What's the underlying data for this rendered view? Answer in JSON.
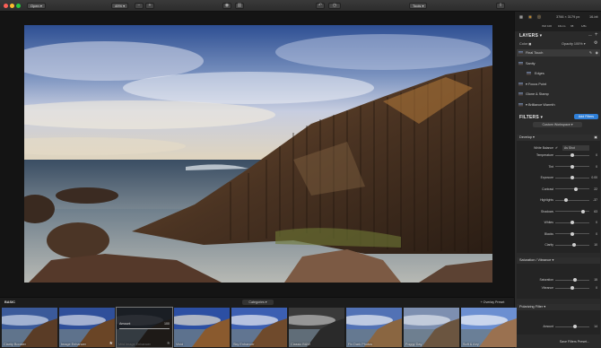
{
  "titlebar": {
    "open_label": "Open ▾",
    "zoom_label": "49% ▾",
    "tools_label": "Tools ▾"
  },
  "meta": {
    "dims": "3766 × 3179 px",
    "bitdepth": "16-bit",
    "iso": "ISO 100",
    "focal": "16mm",
    "fstop": "f/8",
    "exposure": "1/8s"
  },
  "layers": {
    "title": "LAYERS ▾",
    "color_label": "Color ◼",
    "opacity_label": "Opacity 100% ▾",
    "items": [
      {
        "label": "Final Touch"
      },
      {
        "label": "Sanity"
      },
      {
        "label": "Edges"
      },
      {
        "label": "▾ Focus Point"
      },
      {
        "label": "Glone & Stamp"
      },
      {
        "label": "▾ Brilliance Warmth"
      }
    ]
  },
  "filters": {
    "title": "FILTERS ▾",
    "add_label": "Add Filters",
    "workspace_label": "Custom Workspace ▾"
  },
  "develop": {
    "title": "Develop ▾",
    "wb_label": "White Balance",
    "wb_value": "As Shot",
    "sliders": [
      {
        "label": "Temperature",
        "value": "0",
        "pos": 0.5
      },
      {
        "label": "Tint",
        "value": "0",
        "pos": 0.5
      },
      {
        "label": "Exposure",
        "value": "0.00",
        "pos": 0.5
      },
      {
        "label": "Contrast",
        "value": "22",
        "pos": 0.61
      },
      {
        "label": "Highlights",
        "value": "-37",
        "pos": 0.31
      },
      {
        "label": "Shadows",
        "value": "63",
        "pos": 0.81
      },
      {
        "label": "Whites",
        "value": "0",
        "pos": 0.5
      },
      {
        "label": "Blacks",
        "value": "0",
        "pos": 0.5
      },
      {
        "label": "Clarity",
        "value": "10",
        "pos": 0.55
      }
    ]
  },
  "saturation": {
    "title": "Saturation / Vibrance ▾",
    "sliders": [
      {
        "label": "Saturation",
        "value": "15",
        "pos": 0.57
      },
      {
        "label": "Vibrance",
        "value": "0",
        "pos": 0.5
      }
    ]
  },
  "polarizing": {
    "title": "Polarizing Filter ▾",
    "sliders": [
      {
        "label": "Amount",
        "value": "14",
        "pos": 0.57
      }
    ]
  },
  "save_preset_label": "Save Filters Preset...",
  "presets": {
    "category": "BASIC",
    "categories_label": "Categories ▾",
    "overlay_label": "+ Overlay Preset",
    "amount_label": "Amount",
    "amount_value": "100",
    "items": [
      {
        "name": "Clarity Booster",
        "star": false
      },
      {
        "name": "Image Enhancer",
        "star": true
      },
      {
        "name": "Mild Image Enhancer",
        "star": true
      },
      {
        "name": "Vivid",
        "star": false
      },
      {
        "name": "Sky Enhancer",
        "star": false
      },
      {
        "name": "Classic B&W",
        "star": false
      },
      {
        "name": "Fix Dark Photos",
        "star": false
      },
      {
        "name": "Foggy Day",
        "star": false
      },
      {
        "name": "Soft & Airy",
        "star": false
      }
    ]
  }
}
